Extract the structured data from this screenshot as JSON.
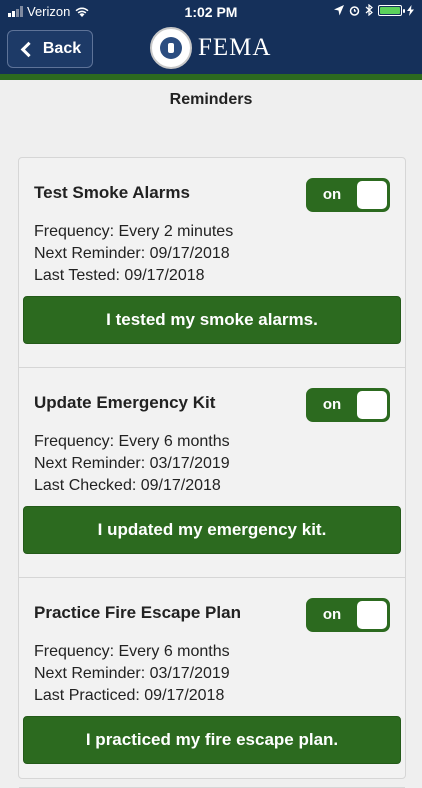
{
  "status_bar": {
    "carrier": "Verizon",
    "time": "1:02 PM",
    "battery_color": "#5bd15b",
    "icons": [
      "signal-icon",
      "wifi-icon",
      "location-icon",
      "alarm-icon",
      "bluetooth-icon",
      "battery-icon",
      "charging-icon"
    ]
  },
  "header": {
    "back_label": "Back",
    "brand": "FEMA",
    "colors": {
      "nav_bg": "#15305a",
      "accent_green": "#2c6a1f"
    }
  },
  "page": {
    "title": "Reminders"
  },
  "reminders": [
    {
      "title": "Test Smoke Alarms",
      "toggle_label": "on",
      "frequency": "Frequency: Every 2 minutes",
      "next": "Next Reminder: 09/17/2018",
      "last": "Last Tested: 09/17/2018",
      "action": "I tested my smoke alarms."
    },
    {
      "title": "Update Emergency Kit",
      "toggle_label": "on",
      "frequency": "Frequency: Every 6 months",
      "next": "Next Reminder: 03/17/2019",
      "last": "Last Checked: 09/17/2018",
      "action": "I updated my emergency kit."
    },
    {
      "title": "Practice Fire Escape Plan",
      "toggle_label": "on",
      "frequency": "Frequency: Every 6 months",
      "next": "Next Reminder: 03/17/2019",
      "last": "Last Practiced: 09/17/2018",
      "action": "I practiced my fire escape plan."
    }
  ]
}
